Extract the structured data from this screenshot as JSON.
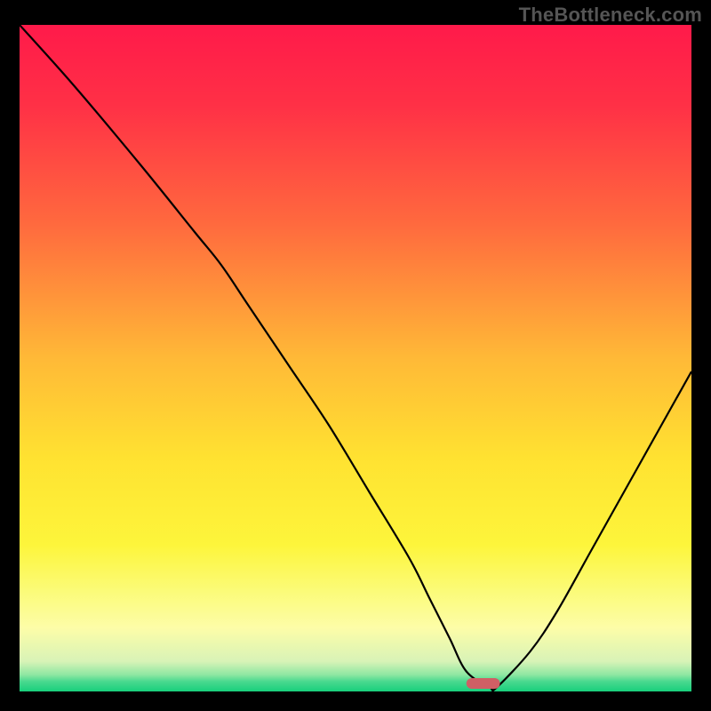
{
  "watermark": "TheBottleneck.com",
  "chart_data": {
    "type": "line",
    "title": "",
    "xlabel": "",
    "ylabel": "",
    "xlim": [
      0,
      100
    ],
    "ylim": [
      0,
      100
    ],
    "grid": false,
    "legend": false,
    "background_gradient": {
      "stops": [
        {
          "offset": 0.0,
          "color": "#ff1a4a"
        },
        {
          "offset": 0.12,
          "color": "#ff3046"
        },
        {
          "offset": 0.3,
          "color": "#ff6a3e"
        },
        {
          "offset": 0.5,
          "color": "#ffb937"
        },
        {
          "offset": 0.65,
          "color": "#ffe231"
        },
        {
          "offset": 0.78,
          "color": "#fdf53b"
        },
        {
          "offset": 0.85,
          "color": "#fbfb79"
        },
        {
          "offset": 0.905,
          "color": "#fdfda8"
        },
        {
          "offset": 0.955,
          "color": "#d8f3b7"
        },
        {
          "offset": 0.975,
          "color": "#8ee7a2"
        },
        {
          "offset": 0.985,
          "color": "#4ad98f"
        },
        {
          "offset": 1.0,
          "color": "#18cf7c"
        }
      ]
    },
    "series": [
      {
        "name": "bottleneck-curve",
        "color": "#000000",
        "x": [
          0,
          8,
          18,
          26,
          30,
          34,
          40,
          46,
          52,
          58,
          61,
          64,
          66.5,
          70,
          71,
          76,
          80,
          85,
          90,
          95,
          100
        ],
        "values": [
          100,
          91,
          79,
          69,
          64,
          58,
          49,
          40,
          30,
          20,
          14,
          8,
          3,
          0.6,
          0.6,
          6,
          12,
          21,
          30,
          39,
          48
        ]
      }
    ],
    "marker": {
      "name": "optimal-range",
      "shape": "rounded-bar",
      "color": "#cf5f65",
      "x_start": 66.5,
      "x_end": 71.5,
      "y": 0.4,
      "height": 1.6
    }
  }
}
